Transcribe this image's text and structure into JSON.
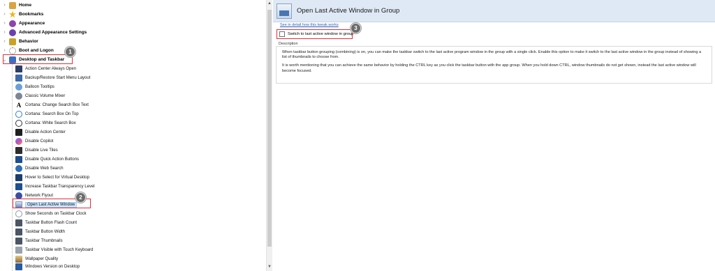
{
  "tree": {
    "categories": [
      {
        "label": "Home",
        "icon": "home-icon",
        "color": "#d9a441",
        "expanded": false
      },
      {
        "label": "Bookmarks",
        "icon": "star-icon",
        "color": "#f2b31b",
        "expanded": false
      },
      {
        "label": "Appearance",
        "icon": "paint-palette-icon",
        "color": "#8e44ad",
        "expanded": false
      },
      {
        "label": "Advanced Appearance Settings",
        "icon": "paint-palette-icon",
        "color": "#6c3fb0",
        "expanded": false
      },
      {
        "label": "Behavior",
        "icon": "behavior-icon",
        "color": "#c9a227",
        "expanded": false
      },
      {
        "label": "Boot and Logon",
        "icon": "boot-logon-icon",
        "color": "#555555",
        "expanded": false
      },
      {
        "label": "Desktop and Taskbar",
        "icon": "desktop-icon",
        "color": "#3b6fc4",
        "expanded": true
      }
    ],
    "items": [
      {
        "label": "Action Center Always Open",
        "icon": "action-center-icon",
        "color": "#2d3e66"
      },
      {
        "label": "Backup/Restore Start Menu Layout",
        "icon": "start-menu-icon",
        "color": "#3d6ba8"
      },
      {
        "label": "Balloon Tooltips",
        "icon": "balloon-icon",
        "color": "#6aa0d8"
      },
      {
        "label": "Classic Volume Mixer",
        "icon": "volume-icon",
        "color": "#7c8694"
      },
      {
        "label": "Cortana: Change Search Box Text",
        "icon": "letter-a-icon",
        "color": "#222222"
      },
      {
        "label": "Cortana: Search Box On Top",
        "icon": "circle-icon",
        "color": "#2b7de9"
      },
      {
        "label": "Cortana: White Search Box",
        "icon": "circle-icon",
        "color": "#333333"
      },
      {
        "label": "Disable Action Center",
        "icon": "action-center-icon",
        "color": "#1f1f1f"
      },
      {
        "label": "Disable Copilot",
        "icon": "copilot-icon",
        "color": "#c84bbd"
      },
      {
        "label": "Disable Live Tiles",
        "icon": "live-tiles-icon",
        "color": "#2d2d2d"
      },
      {
        "label": "Disable Quick Action Buttons",
        "icon": "quick-action-icon",
        "color": "#1f4e8c"
      },
      {
        "label": "Disable Web Search",
        "icon": "globe-icon",
        "color": "#2f6db5"
      },
      {
        "label": "Hover to Select for Virtual Desktop",
        "icon": "virtual-desktop-icon",
        "color": "#1c3d6e"
      },
      {
        "label": "Increase Taskbar Transparency Level",
        "icon": "taskbar-icon",
        "color": "#1e4f91"
      },
      {
        "label": "Network Flyout",
        "icon": "network-icon",
        "color": "#3b4da8"
      },
      {
        "label": "Open Last Active Window",
        "icon": "window-icon",
        "color": "#5b86c2"
      },
      {
        "label": "Show Seconds on Taskbar Clock",
        "icon": "clock-icon",
        "color": "#8a9bb0"
      },
      {
        "label": "Taskbar Button Flash Count",
        "icon": "taskbar-icon",
        "color": "#4c5565"
      },
      {
        "label": "Taskbar Button Width",
        "icon": "taskbar-icon",
        "color": "#4c5565"
      },
      {
        "label": "Taskbar Thumbnails",
        "icon": "thumbnails-icon",
        "color": "#4c5565"
      },
      {
        "label": "Taskbar Visible with Touch Keyboard",
        "icon": "keyboard-icon",
        "color": "#9aa3ad"
      },
      {
        "label": "Wallpaper Quality",
        "icon": "wallpaper-icon",
        "color": "#8a6a3a"
      },
      {
        "label": "Windows Version on Desktop",
        "icon": "windows-version-icon",
        "color": "#2a5aa0"
      }
    ]
  },
  "callouts": [
    "1",
    "2",
    "3"
  ],
  "panel": {
    "title": "Open Last Active Window in Group",
    "detail_link": "See in detail how this tweak works",
    "option_label": "Switch to last active window in group",
    "description_label": "Description",
    "description_p1": "When taskbar button grouping (combining) is on, you can make the taskbar switch to the last active program window in the group with a single click. Enable this option to make it switch to the last active window in the group instead of showing a list of thumbnails to choose from.",
    "description_p2": "It is worth mentioning that you can achieve the same behavior by holding the CTRL key as you click the taskbar button with the app group. When you hold down CTRL, window thumbnails do not get shown, instead the last active window will become focused."
  },
  "colors": {
    "annotation_red": "#e0303a",
    "header_bg": "#dfe9f5",
    "link_blue": "#2a5db0"
  }
}
